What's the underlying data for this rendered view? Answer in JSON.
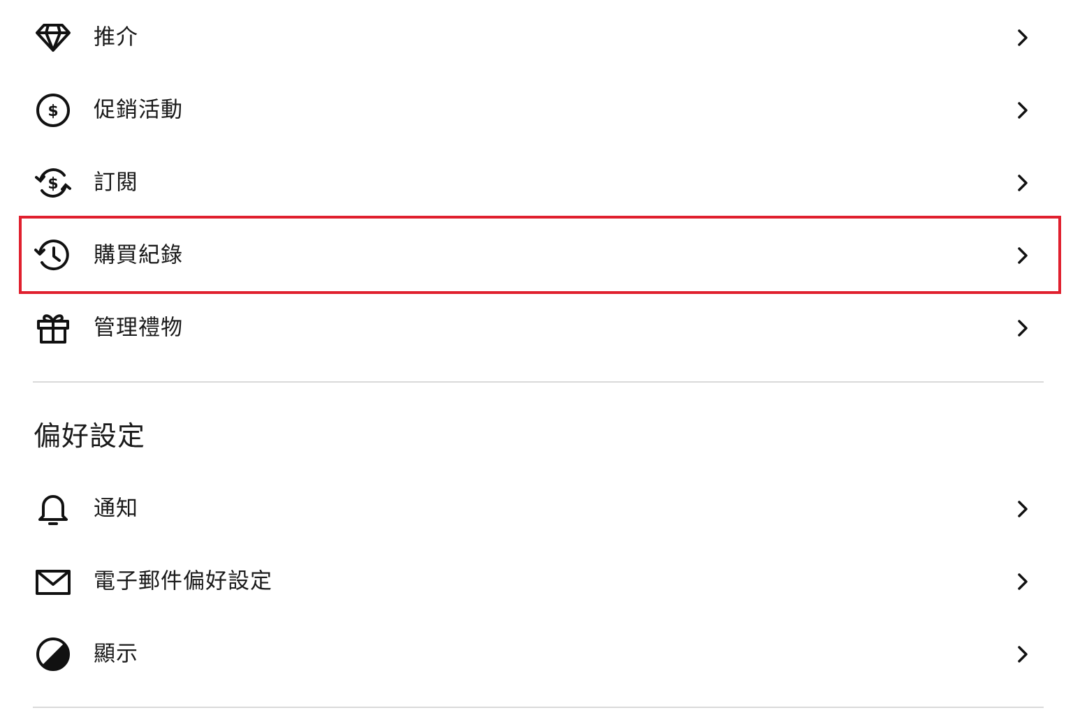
{
  "account_menu": {
    "items": [
      {
        "label": "推介",
        "icon": "diamond-icon"
      },
      {
        "label": "促銷活動",
        "icon": "dollar-circle-icon"
      },
      {
        "label": "訂閱",
        "icon": "subscription-refresh-icon"
      },
      {
        "label": "購買紀錄",
        "icon": "history-clock-icon"
      },
      {
        "label": "管理禮物",
        "icon": "gift-icon"
      }
    ]
  },
  "preferences": {
    "title": "偏好設定",
    "items": [
      {
        "label": "通知",
        "icon": "bell-icon"
      },
      {
        "label": "電子郵件偏好設定",
        "icon": "mail-icon"
      },
      {
        "label": "顯示",
        "icon": "contrast-icon"
      }
    ]
  },
  "colors": {
    "highlight": "#e0202e",
    "text": "#1a1a1a",
    "divider": "#d9d9d9"
  },
  "highlighted_item": "購買紀錄"
}
